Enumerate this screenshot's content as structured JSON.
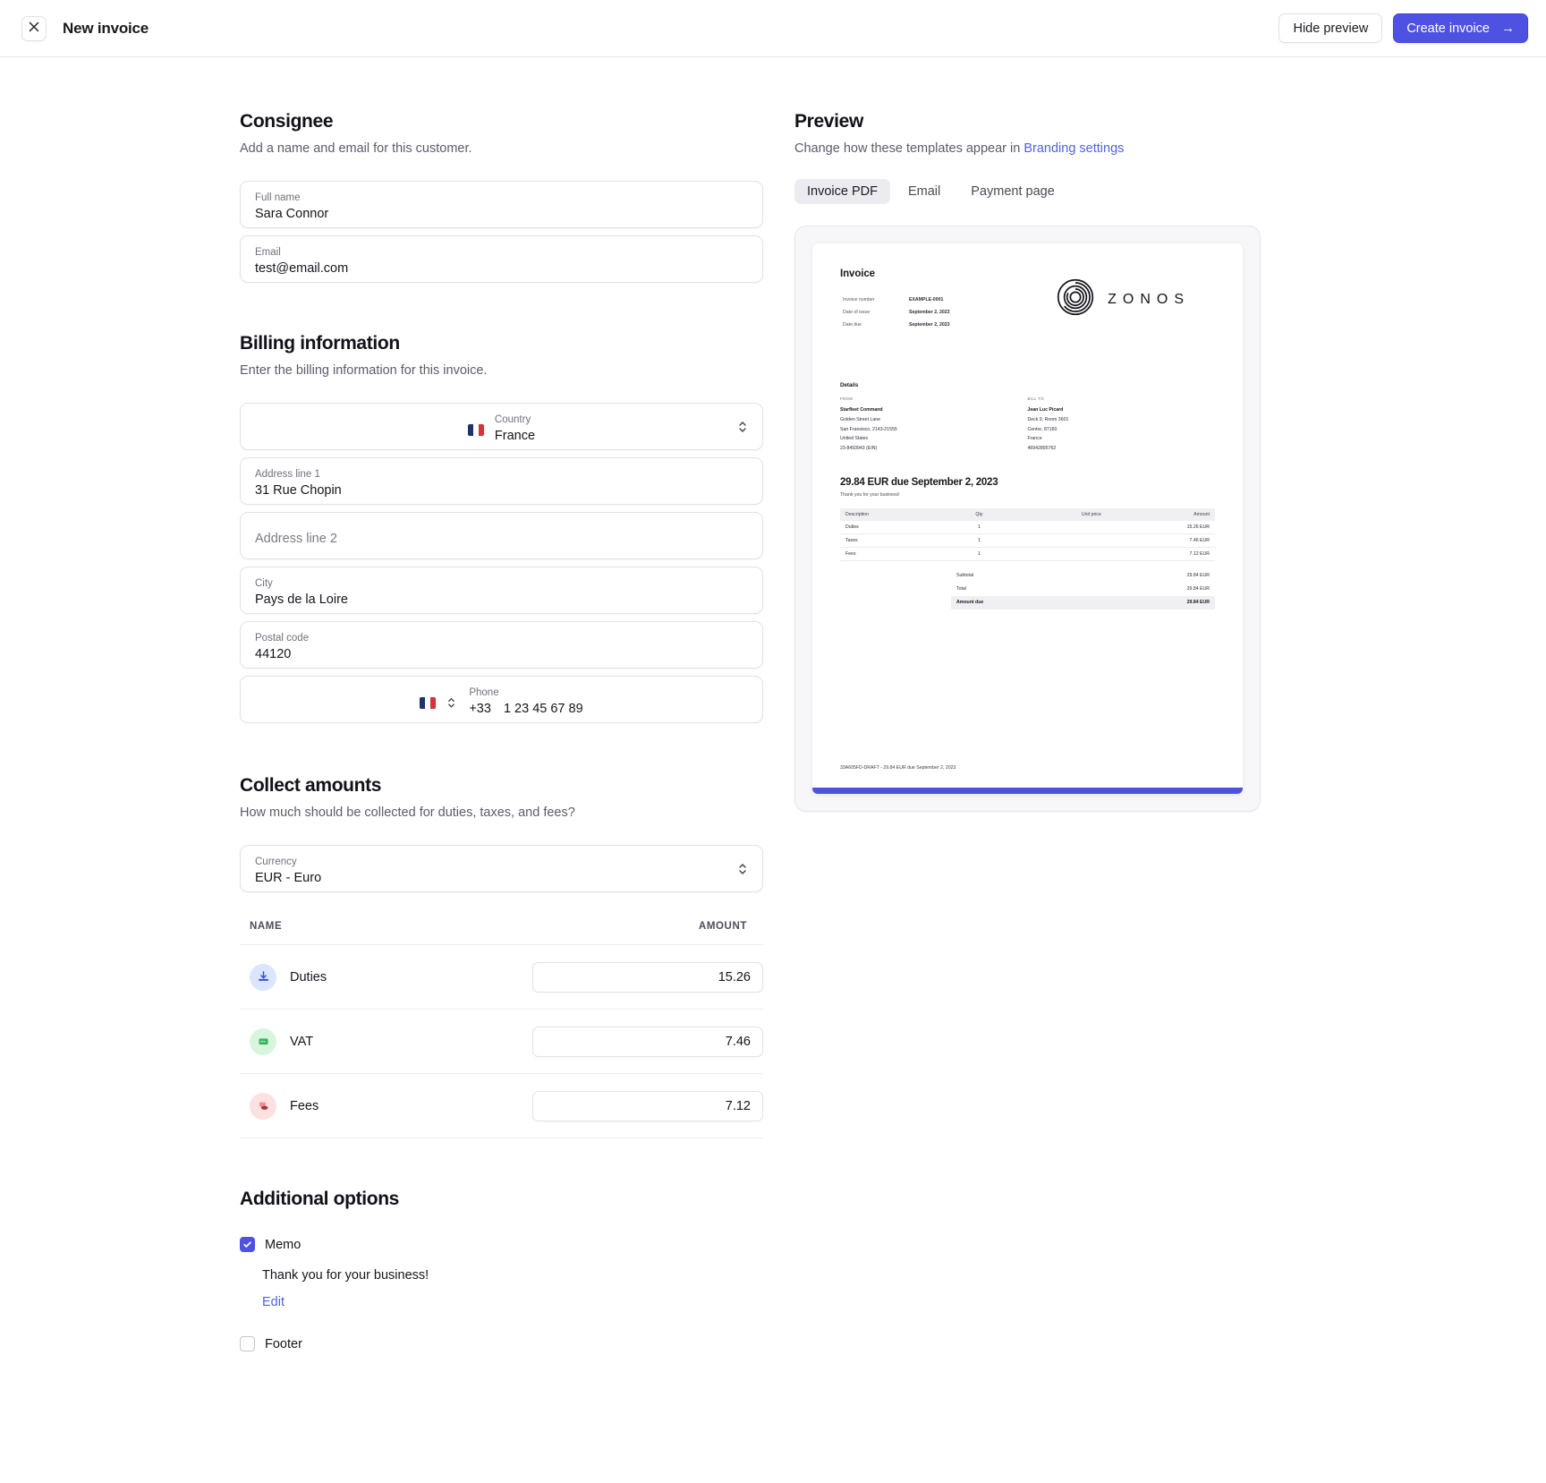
{
  "topbar": {
    "close_icon": "close-icon",
    "title": "New invoice",
    "hide_preview_label": "Hide preview",
    "create_invoice_label": "Create invoice",
    "create_invoice_arrow": "→"
  },
  "consignee": {
    "title": "Consignee",
    "subtitle": "Add a name and email for this customer.",
    "fields": [
      {
        "label": "Full name",
        "value": "Sara Connor"
      },
      {
        "label": "Email",
        "value": "test@email.com"
      }
    ]
  },
  "billing": {
    "title": "Billing information",
    "subtitle": "Enter the billing information for this invoice.",
    "country": {
      "label": "Country",
      "value": "France",
      "flag": "fr-flag-icon"
    },
    "address1": {
      "label": "Address line 1",
      "value": "31 Rue Chopin"
    },
    "address2": {
      "label": "Address line 2",
      "placeholder": "Address line 2",
      "value": ""
    },
    "city": {
      "label": "City",
      "value": "Pays de la Loire"
    },
    "postal": {
      "label": "Postal code",
      "value": "44120"
    },
    "phone": {
      "label": "Phone",
      "code": "+33",
      "value": "1 23 45 67 89",
      "flag": "fr-flag-icon"
    }
  },
  "collect": {
    "title": "Collect amounts",
    "subtitle": "How much should be collected for duties, taxes, and fees?",
    "currency": {
      "label": "Currency",
      "value": "EUR - Euro"
    },
    "columns": {
      "name": "NAME",
      "amount": "AMOUNT"
    },
    "rows": [
      {
        "name": "Duties",
        "amount": "15.26",
        "icon": "duties-import-icon",
        "icon_bg": "#dbe5fd",
        "icon_fg": "#3355d8"
      },
      {
        "name": "VAT",
        "amount": "7.46",
        "icon": "vat-receipt-icon",
        "icon_bg": "#d8f6de",
        "icon_fg": "#27a04a"
      },
      {
        "name": "Fees",
        "amount": "7.12",
        "icon": "fees-stack-icon",
        "icon_bg": "#fde0e0",
        "icon_fg": "#c94040"
      }
    ]
  },
  "additional": {
    "title": "Additional options",
    "memo": {
      "label": "Memo",
      "checked": true,
      "text": "Thank you for your business!",
      "edit_label": "Edit"
    },
    "footer": {
      "label": "Footer",
      "checked": false
    }
  },
  "preview": {
    "title": "Preview",
    "subtitle_prefix": "Change how these templates appear in ",
    "subtitle_link": "Branding settings",
    "tabs": [
      {
        "label": "Invoice PDF",
        "active": true
      },
      {
        "label": "Email",
        "active": false
      },
      {
        "label": "Payment page",
        "active": false
      }
    ]
  },
  "invoice_doc": {
    "heading": "Invoice",
    "meta": [
      {
        "label": "Invoice number",
        "value": "EXAMPLE-0001"
      },
      {
        "label": "Date of issue",
        "value": "September 2, 2023"
      },
      {
        "label": "Date due",
        "value": "September 2, 2023"
      }
    ],
    "brand_name": "ZONOS",
    "brand_logo_icon": "zonos-spiral-logo-icon",
    "details_title": "Details",
    "from": {
      "heading": "FROM",
      "name": "Starfleet Command",
      "lines": [
        "Golden Street Lane",
        "San Fransisco, 2143-21555",
        "United States",
        "23-8493943 (EIN)"
      ]
    },
    "bill_to": {
      "heading": "BILL TO",
      "name": "Jean Luc Picard",
      "lines": [
        "Deck 9, Room 3601",
        "Centre, 87160",
        "France",
        "46942895762"
      ]
    },
    "due_title": "29.84 EUR due September 2, 2023",
    "due_sub": "Thank you for your business!",
    "table": {
      "columns": [
        "Description",
        "Qty",
        "Unit price",
        "Amount"
      ],
      "rows": [
        {
          "description": "Duties",
          "qty": "1",
          "unit_price": "",
          "amount": "15.26 EUR"
        },
        {
          "description": "Taxes",
          "qty": "1",
          "unit_price": "",
          "amount": "7.46 EUR"
        },
        {
          "description": "Fees",
          "qty": "1",
          "unit_price": "",
          "amount": "7.12 EUR"
        }
      ],
      "totals": [
        {
          "label": "Subtotal",
          "value": "29.84 EUR",
          "strong": false
        },
        {
          "label": "Total",
          "value": "29.84 EUR",
          "strong": false
        },
        {
          "label": "Amount due",
          "value": "29.84 EUR",
          "strong": true
        }
      ]
    },
    "footer_text": "33A605FD-DRAFT - 29.84 EUR due September 2, 2023"
  },
  "colors": {
    "accent": "#4f52e0",
    "link": "#4f62e0",
    "border": "#e2e2e8",
    "muted_text": "#5c5c6b"
  }
}
